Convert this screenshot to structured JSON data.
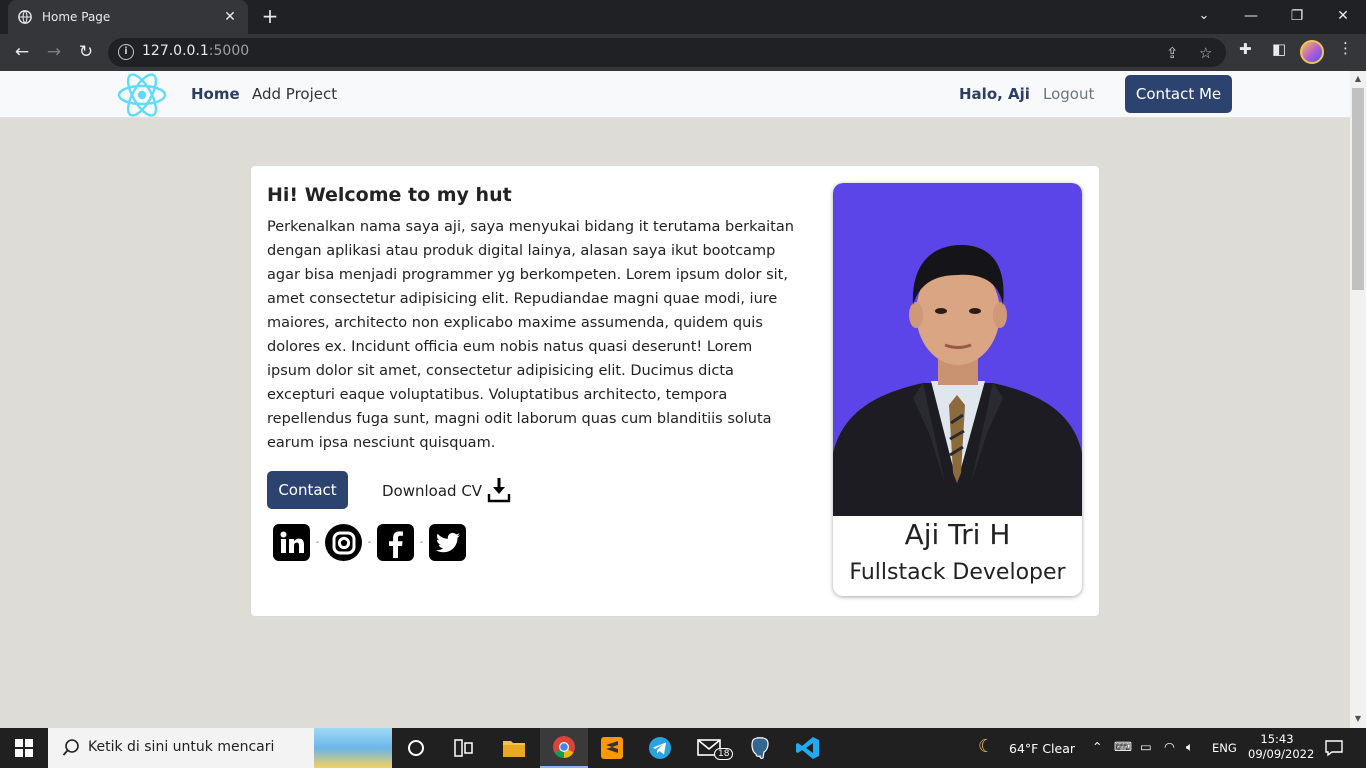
{
  "browser": {
    "tab_title": "Home Page",
    "tab_close": "✕",
    "new_tab": "+",
    "url_host": "127.0.0.1",
    "url_port": ":5000",
    "controls": {
      "minimize": "—",
      "restore": "❐",
      "close": "✕",
      "tab_search": "⌄"
    }
  },
  "navbar": {
    "links": [
      {
        "label": "Home",
        "active": true
      },
      {
        "label": "Add Project",
        "active": false
      }
    ],
    "greeting": "Halo, Aji",
    "logout": "Logout",
    "contact_button": "Contact Me"
  },
  "hero": {
    "title": "Hi! Welcome to my hut",
    "body": "Perkenalkan nama saya aji, saya menyukai bidang it terutama berkaitan dengan aplikasi atau produk digital lainya, alasan saya ikut bootcamp agar bisa menjadi programmer yg berkompeten. Lorem ipsum dolor sit, amet consectetur adipisicing elit. Repudiandae magni quae modi, iure maiores, architecto non explicabo maxime assumenda, quidem quis dolores ex. Incidunt officia eum nobis natus quasi deserunt! Lorem ipsum dolor sit amet, consectetur adipisicing elit. Ducimus dicta excepturi eaque voluptatibus. Voluptatibus architecto, tempora repellendus fuga sunt, magni odit laborum quas cum blanditiis soluta earum ipsa nesciunt quisquam.",
    "contact_button": "Contact",
    "download_cv": "Download CV",
    "social_separator": "-",
    "socials": [
      "linkedin-icon",
      "instagram-icon",
      "facebook-icon",
      "twitter-icon"
    ]
  },
  "profile": {
    "name": "Aji Tri H",
    "role": "Fullstack Developer",
    "photo_bg": "#5b45e8"
  },
  "taskbar": {
    "search_placeholder": "Ketik di sini untuk mencari",
    "mail_badge": "18",
    "weather": "64°F  Clear",
    "language": "ENG",
    "time": "15:43",
    "date": "09/09/2022"
  },
  "colors": {
    "brand": "#2c4370",
    "page_bg": "#dedcd6"
  }
}
